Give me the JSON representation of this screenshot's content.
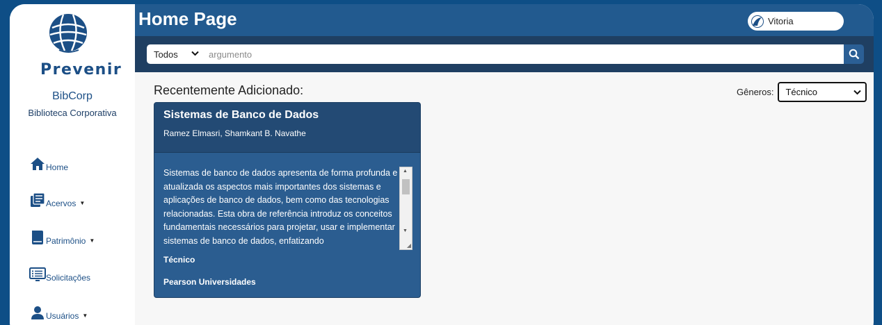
{
  "app": {
    "logo_text": "Prevenir",
    "name": "BibCorp",
    "subtitle": "Biblioteca Corporativa"
  },
  "header": {
    "title": "Home Page"
  },
  "user": {
    "name": "Vitoria"
  },
  "search": {
    "scope_value": "Todos",
    "placeholder": "argumento"
  },
  "sidebar": {
    "items": [
      {
        "label": "Home",
        "icon": "home-icon",
        "has_caret": false
      },
      {
        "label": "Acervos",
        "icon": "books-icon",
        "has_caret": true
      },
      {
        "label": "Patrimônio",
        "icon": "book-icon",
        "has_caret": true
      },
      {
        "label": "Solicitações",
        "icon": "list-screen-icon",
        "has_caret": false
      },
      {
        "label": "Usuários",
        "icon": "user-icon",
        "has_caret": true
      }
    ]
  },
  "main": {
    "section_title": "Recentemente Adicionado:",
    "genres_label": "Gêneros:",
    "genres_selected": "Técnico"
  },
  "book": {
    "title": "Sistemas de Banco de Dados",
    "authors": "Ramez Elmasri, Shamkant B. Navathe",
    "description": "Sistemas de banco de dados apresenta de forma profunda e atualizada os aspectos mais importantes dos sistemas e aplicações de banco de dados, bem como das tecnologias relacionadas. Esta obra de referência introduz os conceitos fundamentais necessários para projetar, usar e implementar sistemas de banco de dados, enfatizando",
    "genre": "Técnico",
    "publisher": "Pearson Universidades"
  },
  "colors": {
    "background": "#0e4e86",
    "header": "#225a8f",
    "search_bar": "#1f3f62",
    "card": "#2b5d90",
    "card_head": "#234a74",
    "brand": "#1c4f86"
  }
}
